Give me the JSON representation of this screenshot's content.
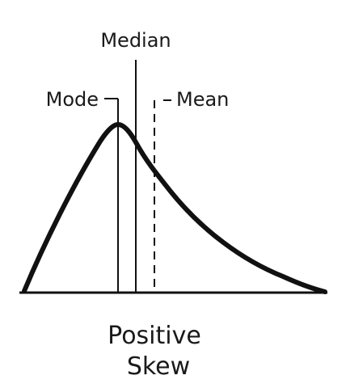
{
  "diagram": {
    "labels": {
      "median": "Median",
      "mode": "Mode",
      "mean": "Mean"
    },
    "caption": {
      "line1": "Positive",
      "line2": "Skew"
    },
    "colors": {
      "stroke": "#111111",
      "text": "#1a1a1a",
      "background": "#ffffff"
    }
  }
}
